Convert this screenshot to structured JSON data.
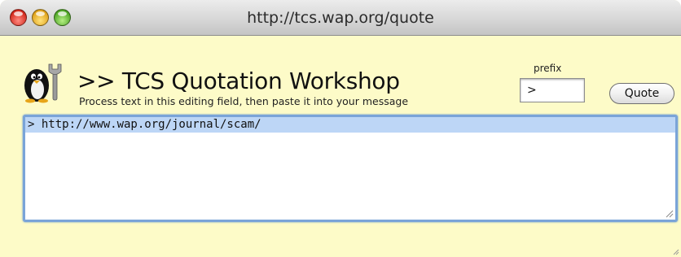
{
  "window": {
    "title": "http://tcs.wap.org/quote"
  },
  "header": {
    "heading": ">> TCS Quotation Workshop",
    "subheading": "Process text in this editing field, then paste it into your message"
  },
  "controls": {
    "prefix_label": "prefix",
    "prefix_value": ">",
    "quote_label": "Quote"
  },
  "editor": {
    "text": "> http://www.wap.org/journal/scam/"
  },
  "colors": {
    "background": "#fdfbc8",
    "selection": "#bdd6f6",
    "focus_ring": "#7aa4d8"
  }
}
